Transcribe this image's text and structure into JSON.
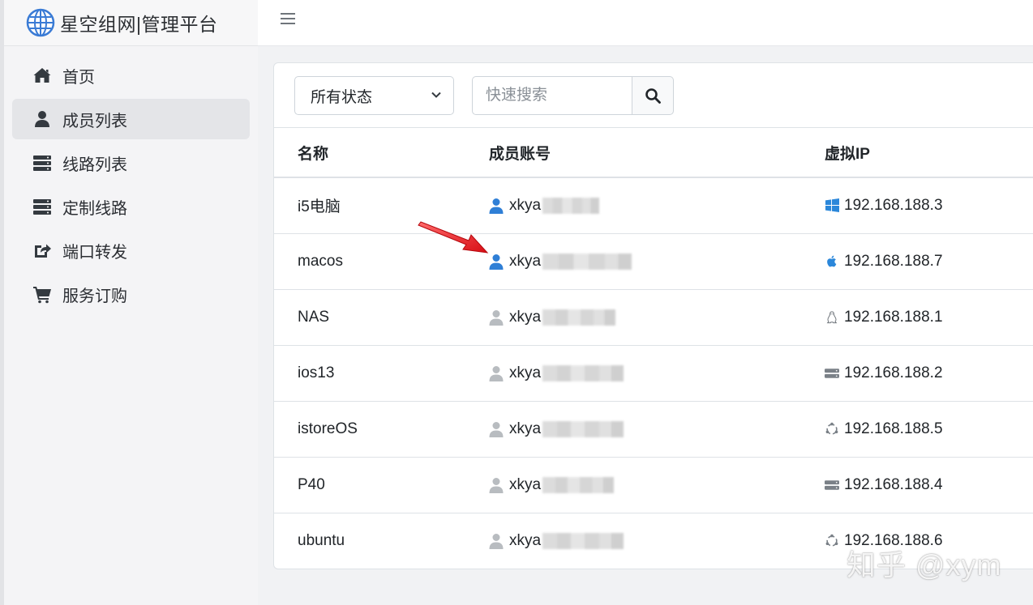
{
  "brand": {
    "title": "星空组网|管理平台",
    "icon": "globe-icon"
  },
  "sidebar": {
    "items": [
      {
        "label": "首页",
        "icon": "home-icon",
        "active": false
      },
      {
        "label": "成员列表",
        "icon": "user-icon",
        "active": true
      },
      {
        "label": "线路列表",
        "icon": "server-icon",
        "active": false
      },
      {
        "label": "定制线路",
        "icon": "server-icon",
        "active": false
      },
      {
        "label": "端口转发",
        "icon": "share-icon",
        "active": false
      },
      {
        "label": "服务订购",
        "icon": "cart-icon",
        "active": false
      }
    ]
  },
  "filters": {
    "status_value": "所有状态",
    "search_placeholder": "快速搜索"
  },
  "table": {
    "headers": [
      "名称",
      "成员账号",
      "虚拟IP"
    ],
    "rows": [
      {
        "name": "i5电脑",
        "account": "xkya",
        "ip": "192.168.188.3",
        "os_icon": "windows-icon",
        "user_color": "#2f7fd6"
      },
      {
        "name": "macos",
        "account": "xkya",
        "ip": "192.168.188.7",
        "os_icon": "apple-icon",
        "user_color": "#2f7fd6"
      },
      {
        "name": "NAS",
        "account": "xkya",
        "ip": "192.168.188.1",
        "os_icon": "linux-icon",
        "user_color": "#b8bcc0"
      },
      {
        "name": "ios13",
        "account": "xkya",
        "ip": "192.168.188.2",
        "os_icon": "server-icon",
        "user_color": "#b8bcc0"
      },
      {
        "name": "istoreOS",
        "account": "xkya",
        "ip": "192.168.188.5",
        "os_icon": "ubuntu-icon",
        "user_color": "#b8bcc0"
      },
      {
        "name": "P40",
        "account": "xkya",
        "ip": "192.168.188.4",
        "os_icon": "server-icon",
        "user_color": "#b8bcc0"
      },
      {
        "name": "ubuntu",
        "account": "xkya",
        "ip": "192.168.188.6",
        "os_icon": "ubuntu-icon",
        "user_color": "#b8bcc0"
      }
    ]
  },
  "watermark": "知乎 @xym",
  "colors": {
    "accent_blue": "#2f7fd6",
    "inactive_grey": "#b8bcc0",
    "annotation_red": "#e8141b"
  }
}
